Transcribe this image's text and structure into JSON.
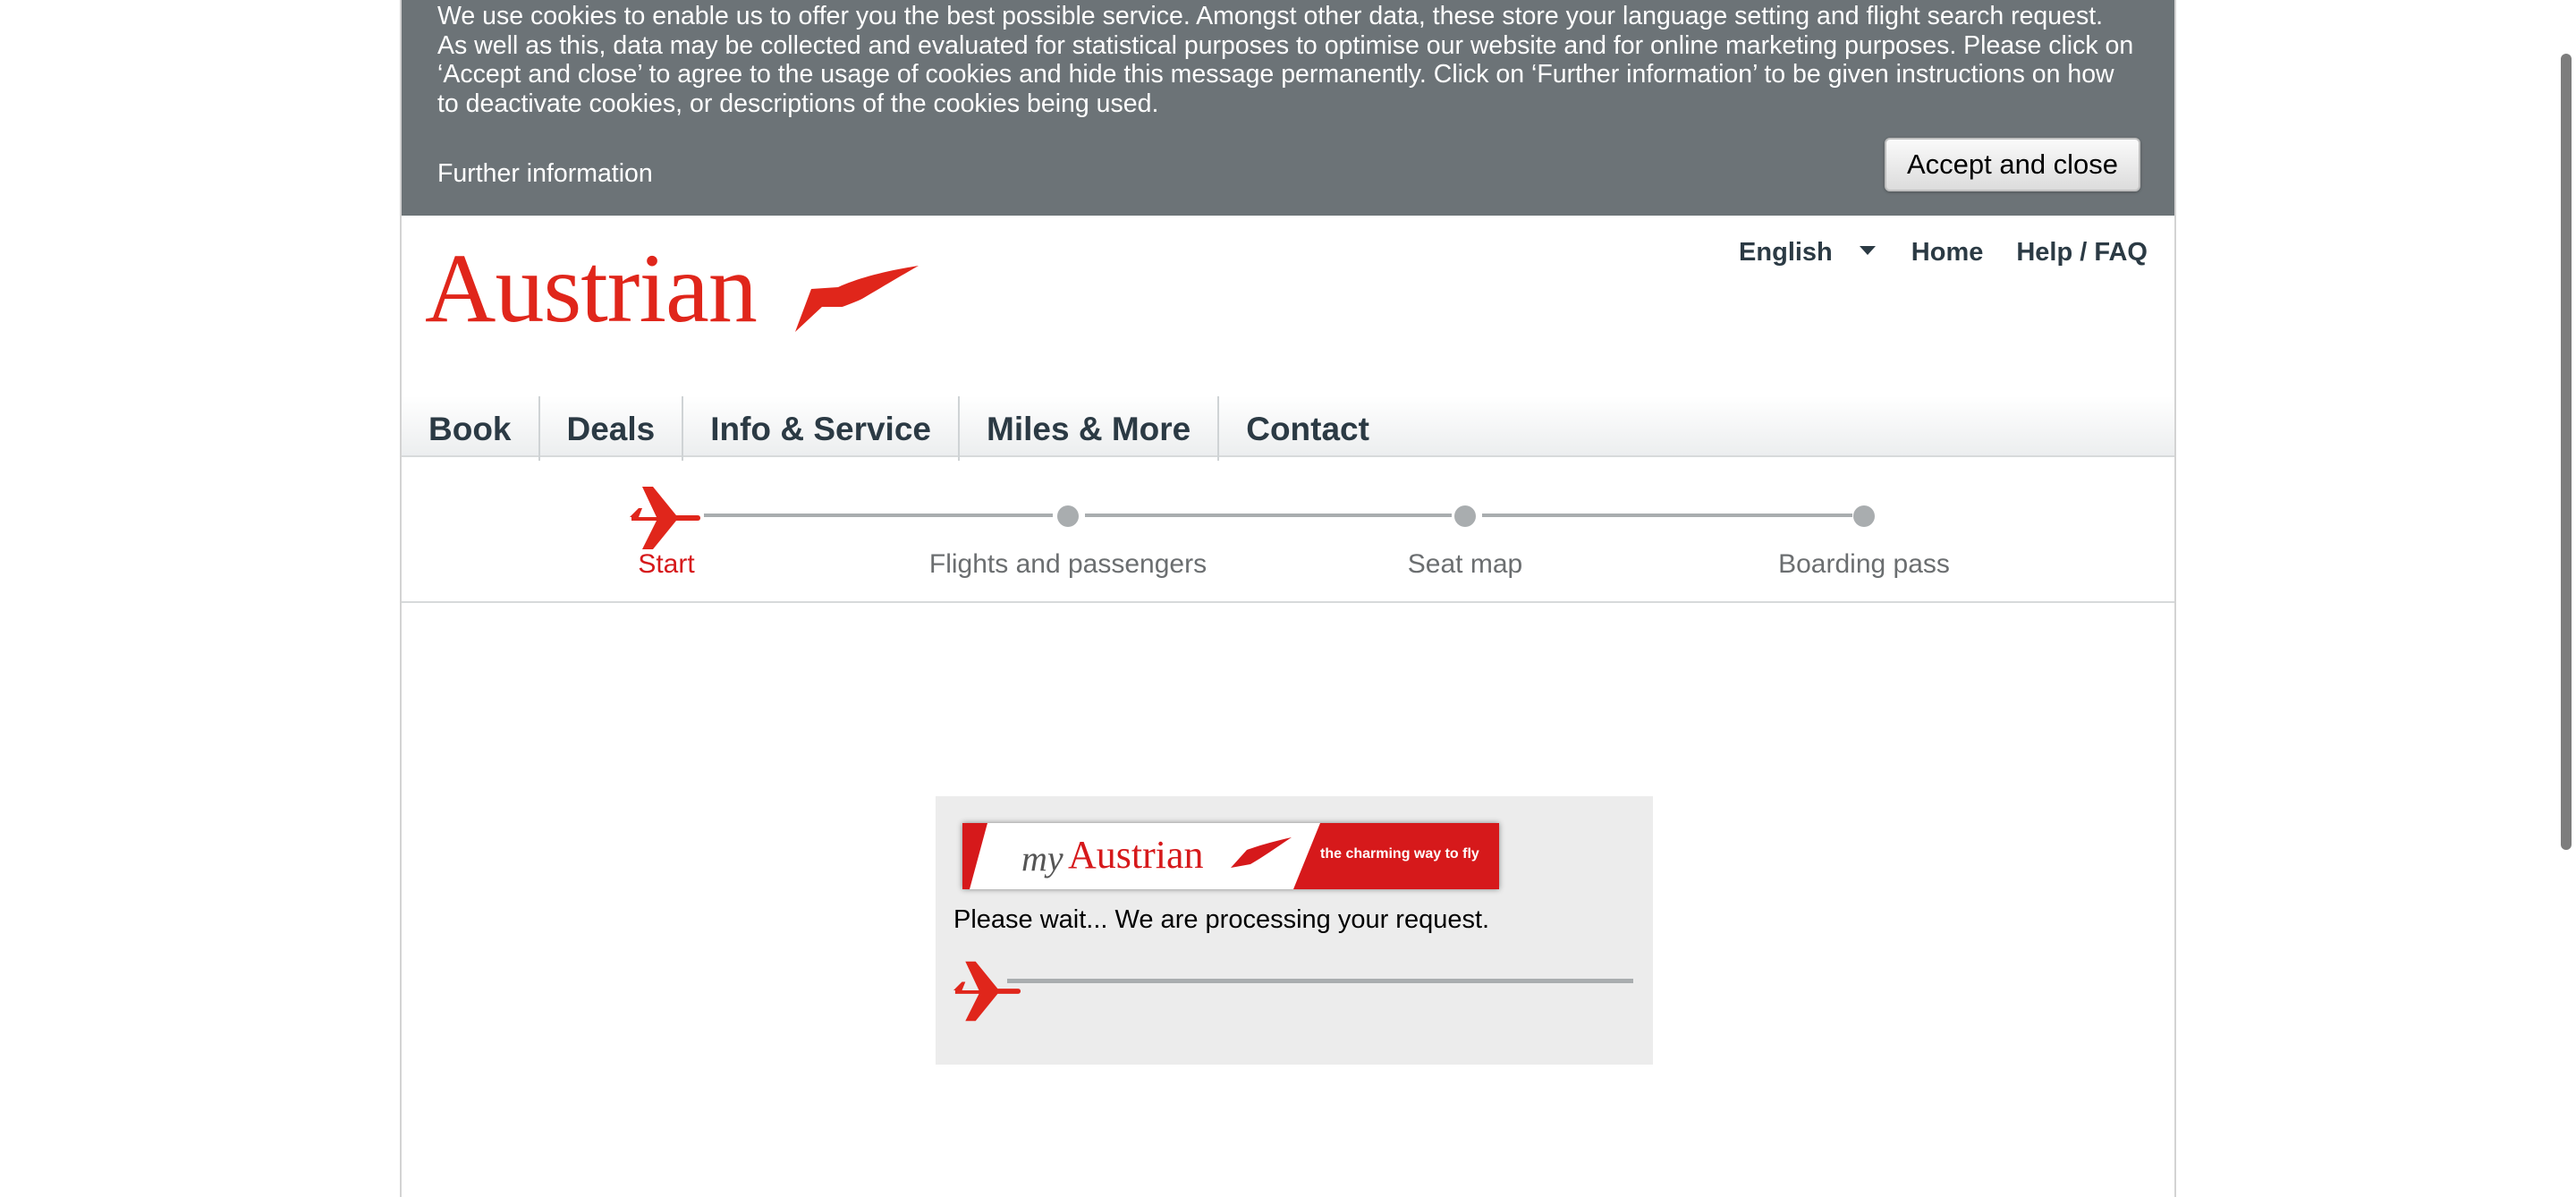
{
  "cookie_banner": {
    "text": "We use cookies to enable us to offer you the best possible service. Amongst other data, these store your language setting and flight search request. As well as this, data may be collected and evaluated for statistical purposes to optimise our website and for online marketing purposes. Please click on ‘Accept and close’ to agree to the usage of cookies and hide this message permanently. Click on ‘Further information’ to be given instructions on how to deactivate cookies, or descriptions of the cookies being used.",
    "further_info_label": "Further information",
    "accept_label": "Accept and close"
  },
  "header": {
    "logo_text": "Austrian",
    "meta_nav": {
      "language": "English",
      "home": "Home",
      "help": "Help / FAQ"
    }
  },
  "main_nav": {
    "items": [
      "Book",
      "Deals",
      "Info & Service",
      "Miles & More",
      "Contact"
    ]
  },
  "stepper": {
    "steps": [
      "Start",
      "Flights and passengers",
      "Seat map",
      "Boarding pass"
    ],
    "active_index": 0
  },
  "loader": {
    "banner_my": "my",
    "banner_name": "Austrian",
    "banner_tagline": "the charming way to fly",
    "message": "Please wait... We are processing your request."
  },
  "colors": {
    "brand_red": "#e0261b",
    "banner_gray": "#6c7377",
    "nav_text": "#2b3a44"
  },
  "icons": [
    "chevron-down-icon",
    "plane-icon",
    "swoosh-logo-icon"
  ]
}
